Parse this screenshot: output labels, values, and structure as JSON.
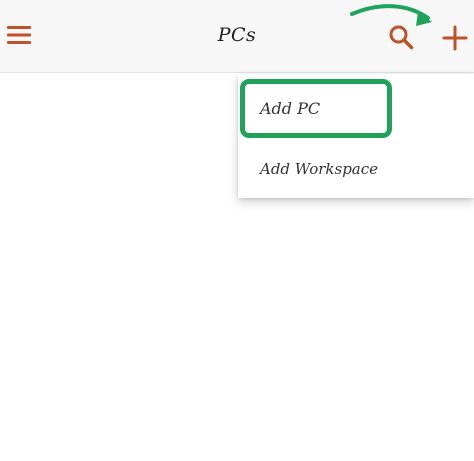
{
  "appbar": {
    "title": "PCs",
    "menu_icon": "hamburger-menu-icon",
    "search_icon": "search-icon",
    "add_icon": "plus-icon"
  },
  "dropdown": {
    "items": [
      {
        "label": "Add PC"
      },
      {
        "label": "Add Workspace"
      }
    ]
  },
  "colors": {
    "accent": "#c0522a",
    "annotation": "#1fa35a",
    "appbar_bg": "#f7f7f7"
  }
}
